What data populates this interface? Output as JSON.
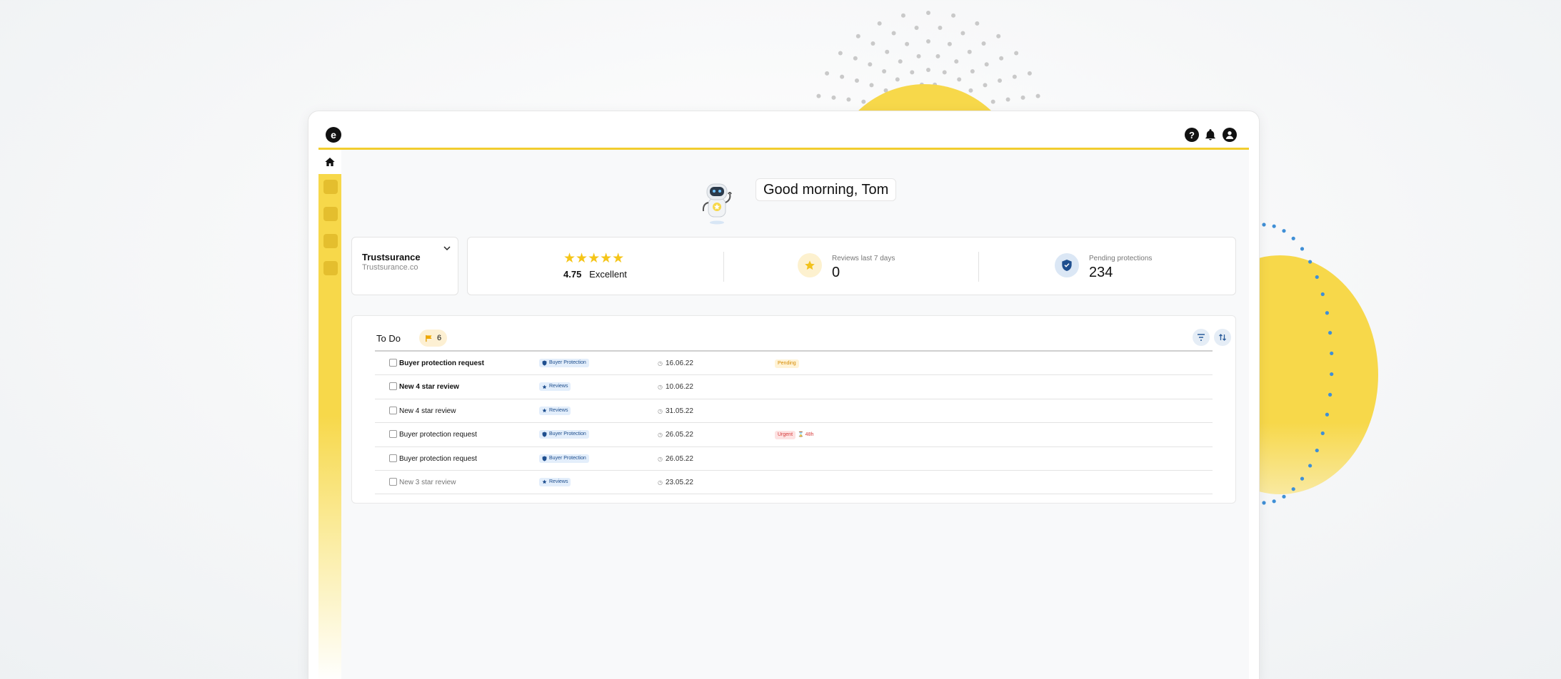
{
  "header": {
    "logo_letter": "e",
    "icons": [
      "help-icon",
      "bell-icon",
      "user-icon"
    ],
    "help_glyph": "?"
  },
  "sidebar": {
    "home_icon": "home-icon",
    "items": [
      "nav-item-1",
      "nav-item-2",
      "nav-item-3",
      "nav-item-4"
    ]
  },
  "greeting": {
    "text": "Good morning, Tom"
  },
  "shop": {
    "name": "Trustsurance",
    "url": "Trustsurance.co"
  },
  "stats": {
    "rating": {
      "stars": "★★★★★",
      "value": "4.75",
      "label": "Excellent"
    },
    "reviews": {
      "label": "Reviews last 7 days",
      "value": "0"
    },
    "protections": {
      "label": "Pending protections",
      "value": "234"
    }
  },
  "todo": {
    "title": "To Do",
    "badge_count": "6",
    "rows": [
      {
        "title": "Buyer protection request",
        "category": "Buyer Protection",
        "date": "16.06.22",
        "status": "Pending",
        "timer": "",
        "bold": true
      },
      {
        "title": "New 4 star review",
        "category": "Reviews",
        "date": "10.06.22",
        "status": "",
        "timer": "",
        "bold": true
      },
      {
        "title": "New 4 star review",
        "category": "Reviews",
        "date": "31.05.22",
        "status": "",
        "timer": "",
        "bold": false
      },
      {
        "title": "Buyer protection request",
        "category": "Buyer Protection",
        "date": "26.05.22",
        "status": "Urgent",
        "timer": "48h",
        "bold": false
      },
      {
        "title": "Buyer protection request",
        "category": "Buyer Protection",
        "date": "26.05.22",
        "status": "",
        "timer": "",
        "bold": false
      },
      {
        "title": "New 3 star review",
        "category": "Reviews",
        "date": "23.05.22",
        "status": "",
        "timer": "",
        "bold": false,
        "faded": true
      }
    ]
  },
  "colors": {
    "accent_yellow": "#f7d84a",
    "sidebar_item": "#e4be2e",
    "tag_blue_bg": "#e3eefb",
    "tag_blue_text": "#1b4c8c",
    "pending": "#d58a00",
    "urgent": "#d63a3a"
  }
}
